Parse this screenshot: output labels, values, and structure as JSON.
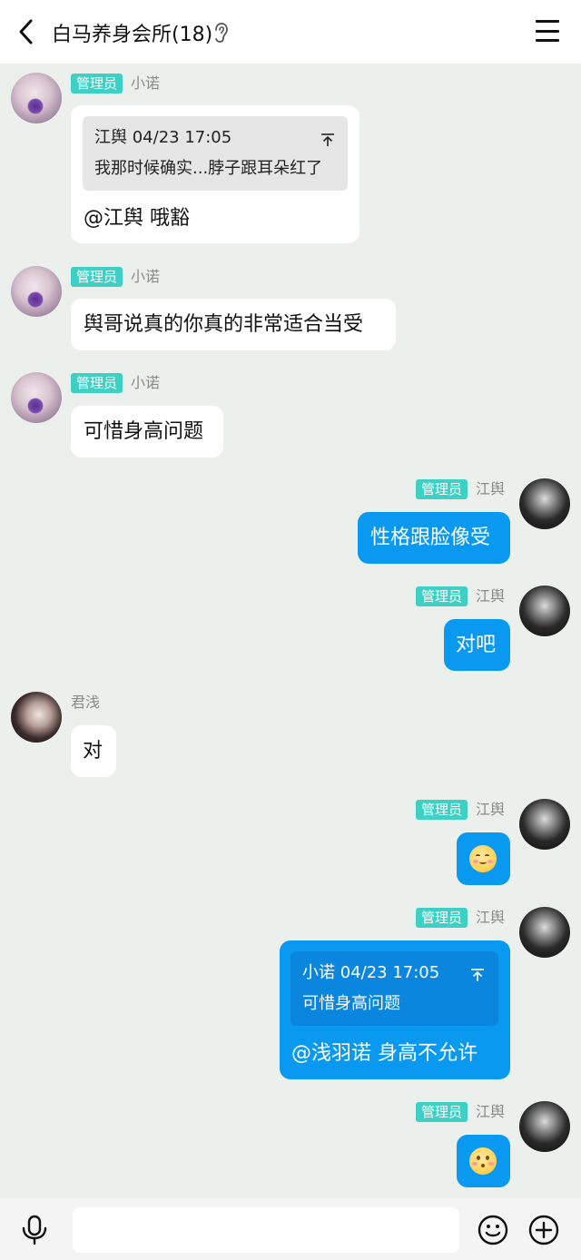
{
  "header": {
    "title": "白马养身会所(18)",
    "back_icon": "chevron-left-icon",
    "ear_icon": "ear-icon",
    "menu_icon": "hamburger-menu-icon"
  },
  "messages": [
    {
      "side": "left",
      "sender": "小诺",
      "badge": "管理员",
      "quote": {
        "meta": "江舆 04/23 17:05",
        "text": "我那时候确实...脖子跟耳朵红了"
      },
      "text": "@江舆 哦豁"
    },
    {
      "side": "left",
      "sender": "小诺",
      "badge": "管理员",
      "text": "舆哥说真的你真的非常适合当受"
    },
    {
      "side": "left",
      "sender": "小诺",
      "badge": "管理员",
      "text": "可惜身高问题"
    },
    {
      "side": "right",
      "sender": "江舆",
      "badge": "管理员",
      "text": "性格跟脸像受"
    },
    {
      "side": "right",
      "sender": "江舆",
      "badge": "管理员",
      "text": "对吧"
    },
    {
      "side": "left",
      "sender": "君浅",
      "text": "对"
    },
    {
      "side": "right",
      "sender": "江舆",
      "badge": "管理员",
      "emoji": "smiling-blush-emoji"
    },
    {
      "side": "right",
      "sender": "江舆",
      "badge": "管理员",
      "quote": {
        "meta": "小诺 04/23 17:05",
        "text": "可惜身高问题"
      },
      "text": "@浅羽诺 身高不允许"
    },
    {
      "side": "right",
      "sender": "江舆",
      "badge": "管理员",
      "emoji": "blushing-face-emoji"
    }
  ],
  "input_bar": {
    "placeholder": "",
    "mic_icon": "microphone-icon",
    "emoji_icon": "smiley-icon",
    "plus_icon": "plus-circle-icon"
  },
  "colors": {
    "background": "#ecf0ec",
    "badge": "#3ed0c4",
    "right_bubble": "#0a99f0",
    "left_bubble": "#ffffff"
  }
}
